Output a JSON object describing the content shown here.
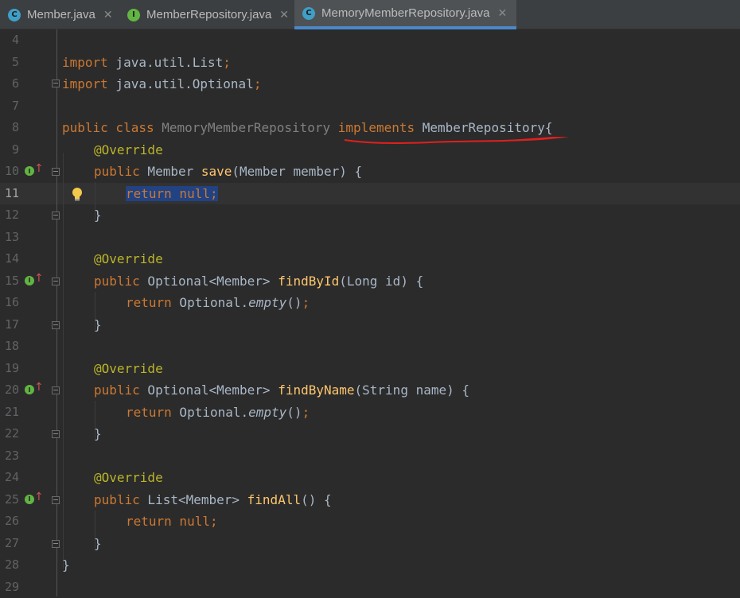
{
  "tabs": [
    {
      "label": "Member.java",
      "icon": "class-icon",
      "active": false
    },
    {
      "label": "MemberRepository.java",
      "icon": "interface-icon",
      "active": false
    },
    {
      "label": "MemoryMemberRepository.java",
      "icon": "class-icon",
      "active": true
    }
  ],
  "colors": {
    "background": "#2b2b2b",
    "keyword": "#cc7832",
    "annotation": "#bbb529",
    "method": "#ffc66d",
    "text": "#a9b7c6",
    "selection": "#214283",
    "tab_accent": "#4a88c7",
    "underline": "#e0201e"
  },
  "editor": {
    "current_line": "11",
    "lines": [
      {
        "n": "4"
      },
      {
        "n": "5",
        "t1": "import",
        "t2": " java.util.List",
        "t3": ";"
      },
      {
        "n": "6",
        "t1": "import",
        "t2": " java.util.Optional",
        "t3": ";"
      },
      {
        "n": "7"
      },
      {
        "n": "8",
        "t1": "public class",
        "t2": " MemoryMemberRepository ",
        "t3": "implements",
        "t4": " MemberRepository{"
      },
      {
        "n": "9",
        "t1": "@Override"
      },
      {
        "n": "10",
        "t1": "public",
        "t2": " Member ",
        "t3": "save",
        "t4": "(Member member) {"
      },
      {
        "n": "11",
        "t1": "return null;"
      },
      {
        "n": "12",
        "t1": "}"
      },
      {
        "n": "13"
      },
      {
        "n": "14",
        "t1": "@Override"
      },
      {
        "n": "15",
        "t1": "public",
        "t2": " Optional<Member> ",
        "t3": "findById",
        "t4": "(Long id) {"
      },
      {
        "n": "16",
        "t1": "return",
        "t2": " Optional.",
        "t3": "empty",
        "t4": "()",
        "t5": ";"
      },
      {
        "n": "17",
        "t1": "}"
      },
      {
        "n": "18"
      },
      {
        "n": "19",
        "t1": "@Override"
      },
      {
        "n": "20",
        "t1": "public",
        "t2": " Optional<Member> ",
        "t3": "findByName",
        "t4": "(String name) {"
      },
      {
        "n": "21",
        "t1": "return",
        "t2": " Optional.",
        "t3": "empty",
        "t4": "()",
        "t5": ";"
      },
      {
        "n": "22",
        "t1": "}"
      },
      {
        "n": "23"
      },
      {
        "n": "24",
        "t1": "@Override"
      },
      {
        "n": "25",
        "t1": "public",
        "t2": " List<Member> ",
        "t3": "findAll",
        "t4": "() {"
      },
      {
        "n": "26",
        "t1": "return null;"
      },
      {
        "n": "27",
        "t1": "}"
      },
      {
        "n": "28",
        "t1": "}"
      },
      {
        "n": "29"
      }
    ]
  }
}
